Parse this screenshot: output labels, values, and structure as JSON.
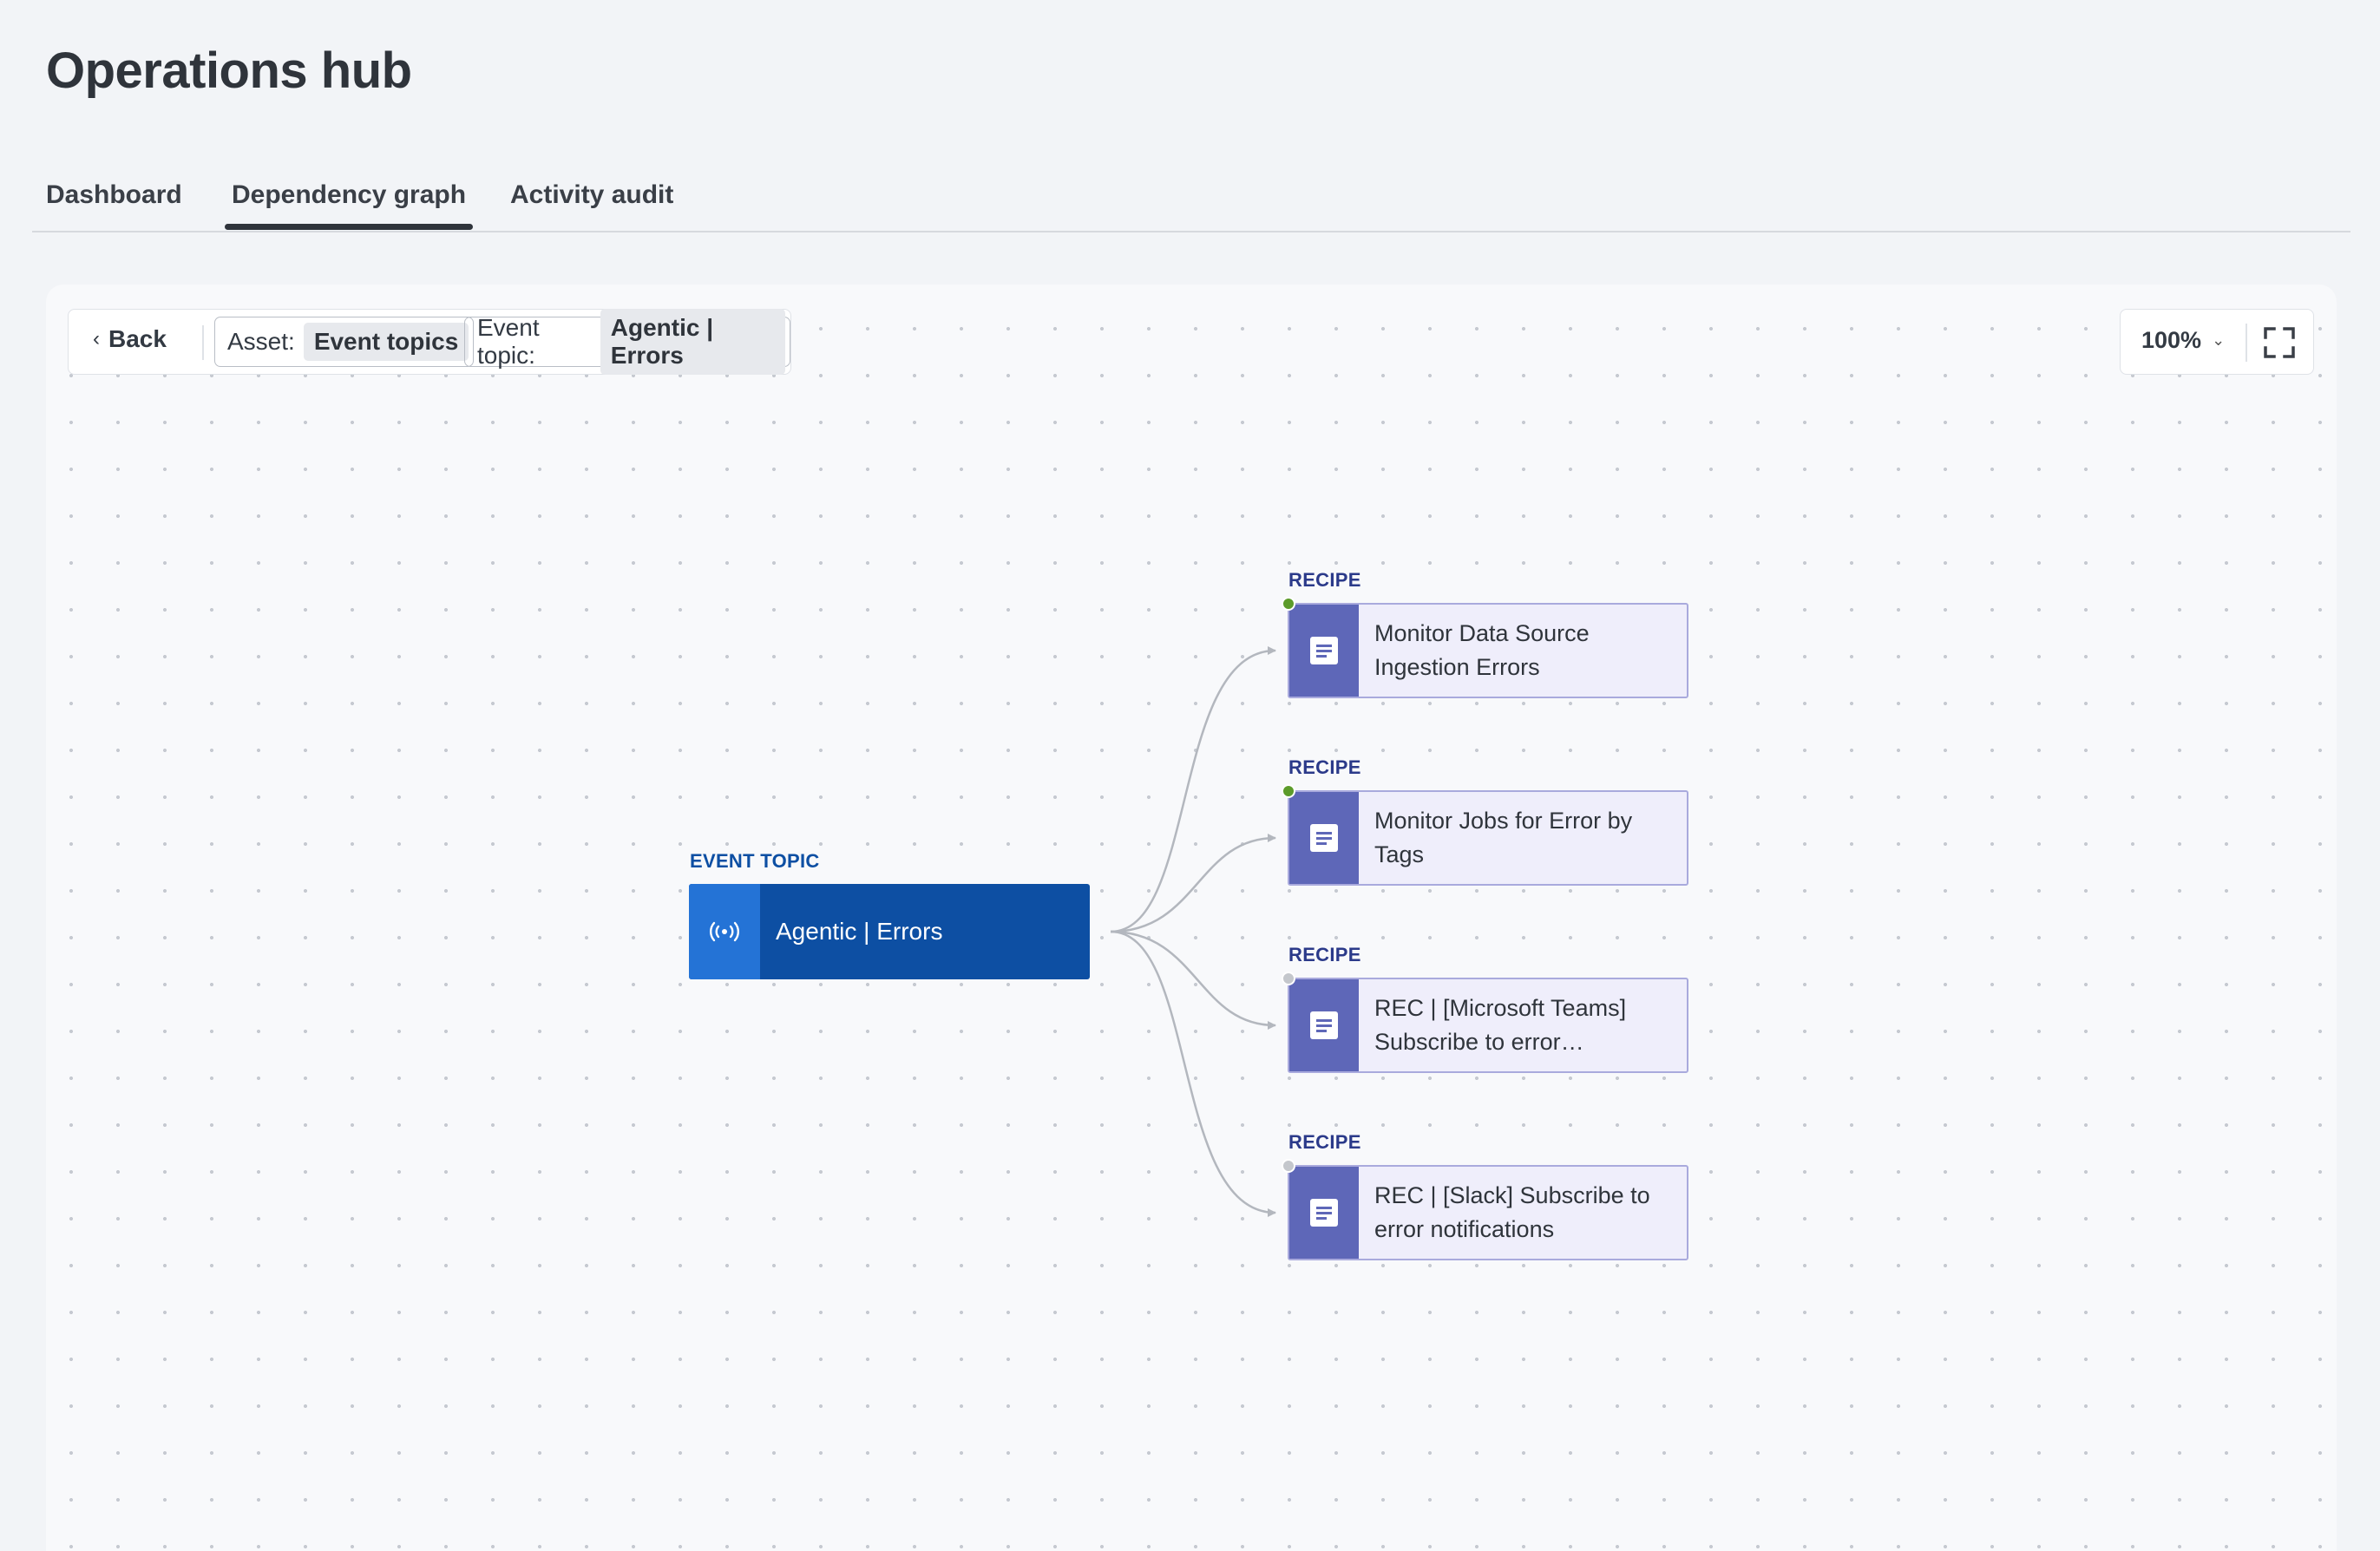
{
  "page": {
    "title": "Operations hub"
  },
  "tabs": [
    {
      "label": "Dashboard",
      "active": false
    },
    {
      "label": "Dependency graph",
      "active": true
    },
    {
      "label": "Activity audit",
      "active": false
    }
  ],
  "toolbar": {
    "back_label": "Back",
    "back_icon": "chevron-left-icon",
    "asset_filter": {
      "label": "Asset:",
      "value": "Event topics"
    },
    "topic_filter": {
      "label": "Event topic:",
      "value": "Agentic | Errors"
    }
  },
  "zoom": {
    "value": "100%",
    "fullscreen_icon": "fullscreen-icon"
  },
  "graph": {
    "source": {
      "caption": "EVENT TOPIC",
      "name": "Agentic | Errors",
      "icon": "broadcast-icon",
      "color": "#0d4fa3",
      "icon_bg": "#2473d6"
    },
    "recipes": [
      {
        "caption": "RECIPE",
        "name": "Monitor Data Source Ingestion Errors",
        "status": "active",
        "status_color": "#5c9b2a"
      },
      {
        "caption": "RECIPE",
        "name": "Monitor Jobs for Error by Tags",
        "status": "active",
        "status_color": "#5c9b2a"
      },
      {
        "caption": "RECIPE",
        "name": "REC | [Microsoft Teams] Subscribe to error…",
        "status": "inactive",
        "status_color": "#c4c7cc"
      },
      {
        "caption": "RECIPE",
        "name": "REC | [Slack] Subscribe to error notifications",
        "status": "inactive",
        "status_color": "#c4c7cc"
      }
    ]
  },
  "colors": {
    "caption_event": "#0d4fa3",
    "caption_recipe": "#2b3a8a",
    "recipe_icon_bg": "#5e67b8",
    "recipe_bg": "#efeefb",
    "edge": "#b3b7be"
  }
}
